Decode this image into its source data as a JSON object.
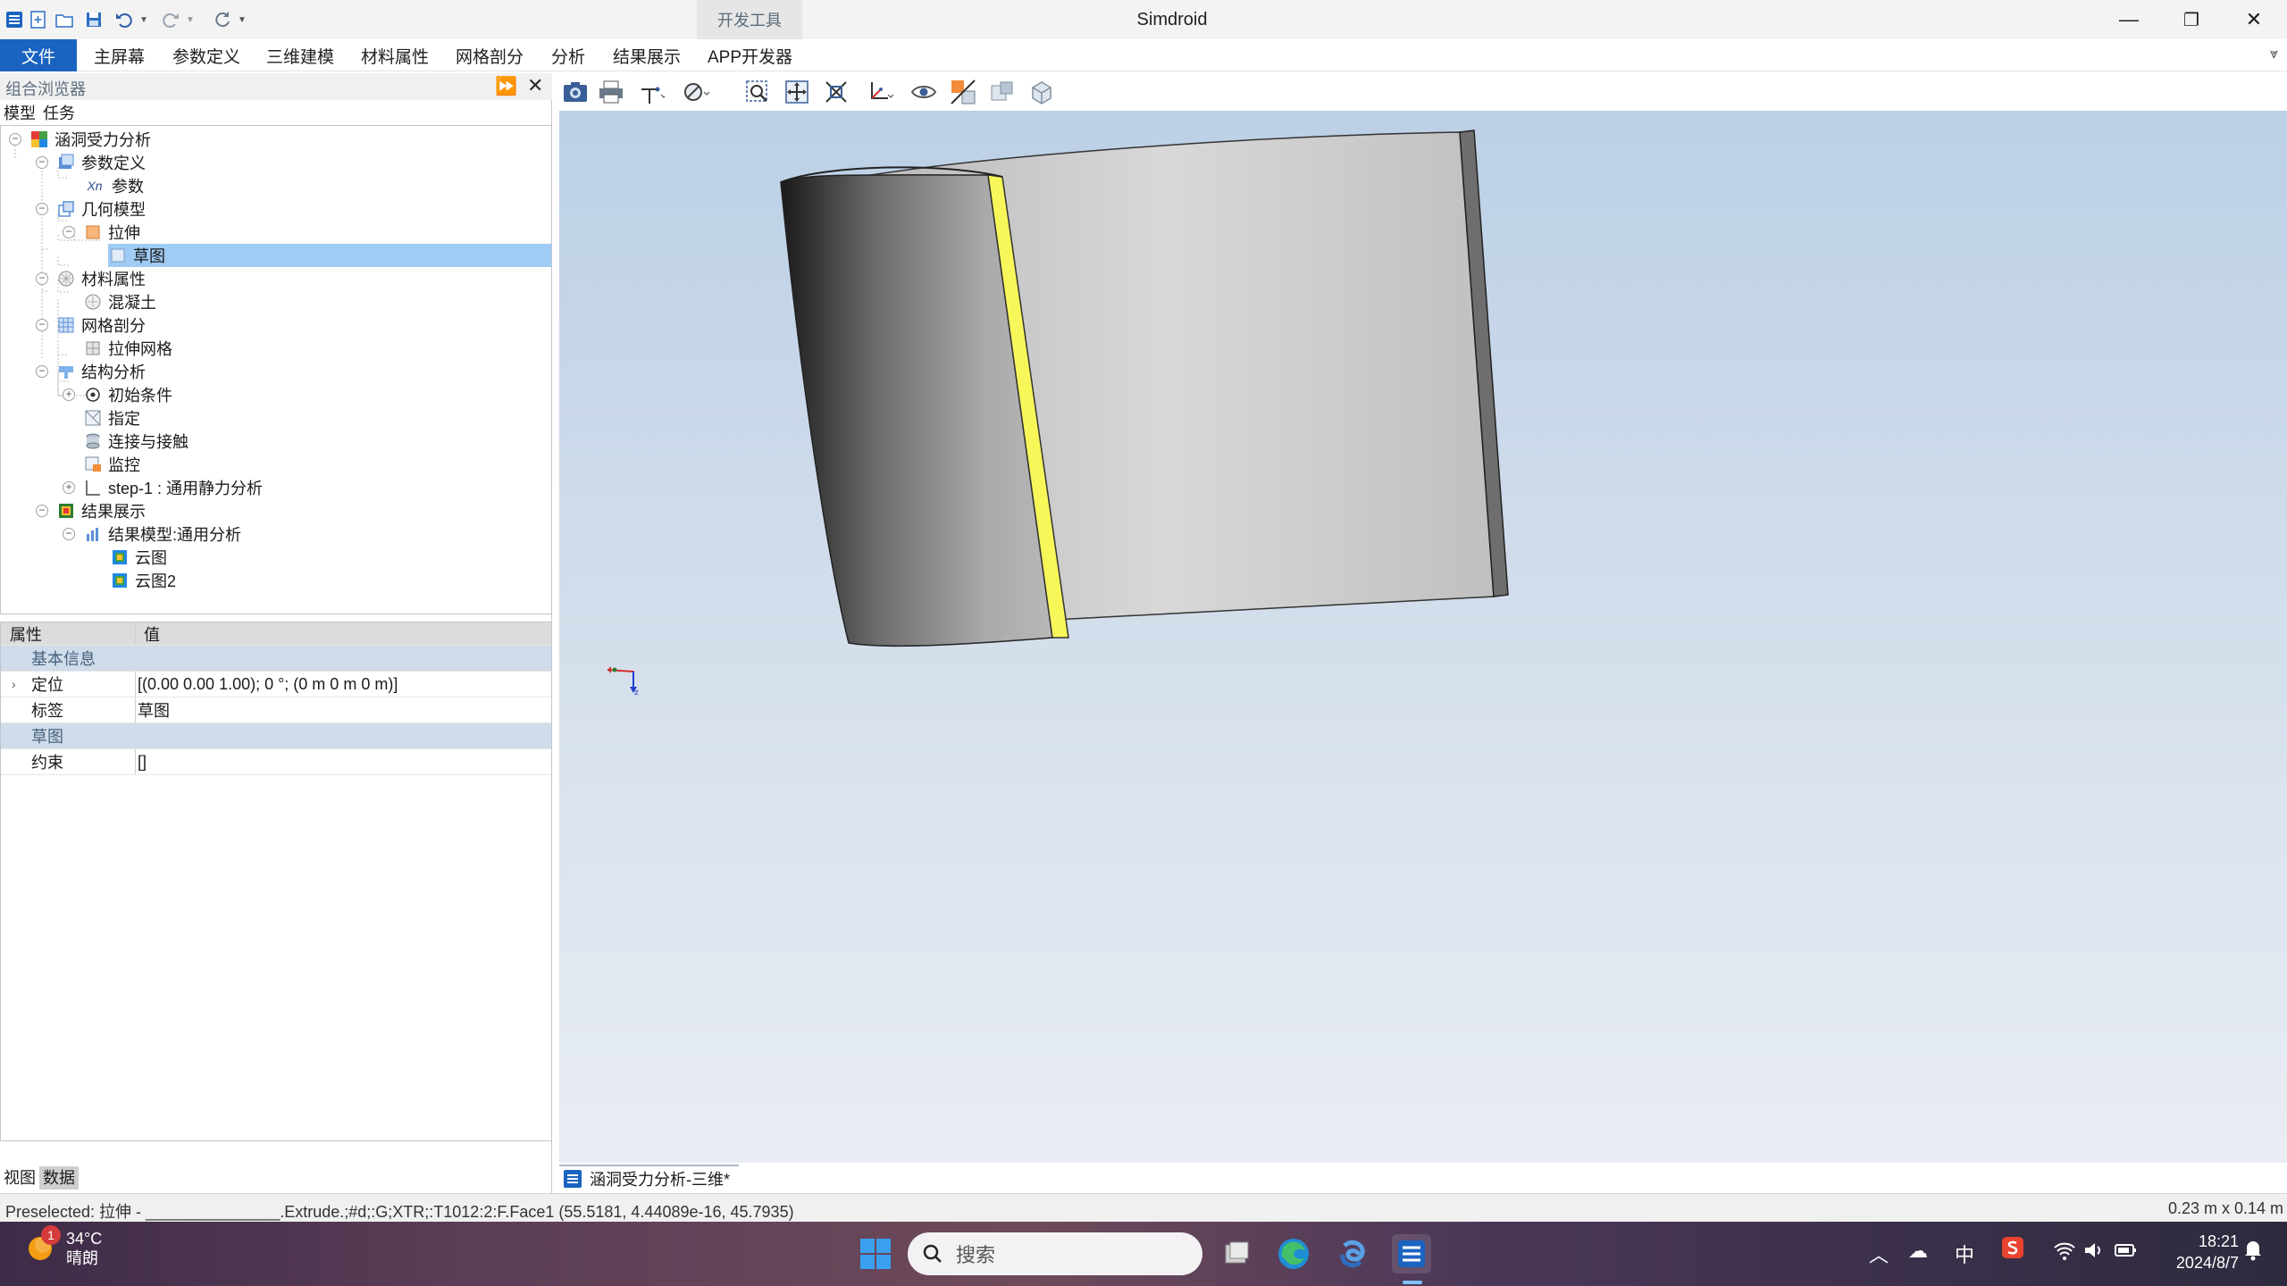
{
  "titlebar": {
    "app_title": "Simdroid",
    "context_tab": "开发工具",
    "minimize": "—",
    "restore": "❐",
    "close": "✕"
  },
  "menu": {
    "file": "文件",
    "items": [
      "主屏幕",
      "参数定义",
      "三维建模",
      "材料属性",
      "网格剖分",
      "分析",
      "结果展示",
      "APP开发器"
    ]
  },
  "left_panel": {
    "title": "组合浏览器",
    "tabs": [
      "模型",
      "任务"
    ],
    "bottom_tabs": [
      "视图",
      "数据"
    ]
  },
  "tree": {
    "root": "涵洞受力分析",
    "param_def": "参数定义",
    "params": "参数",
    "geom_model": "几何模型",
    "extrude": "拉伸",
    "sketch": "草图",
    "material": "材料属性",
    "concrete": "混凝土",
    "mesh": "网格剖分",
    "extrude_mesh": "拉伸网格",
    "struct": "结构分析",
    "init_cond": "初始条件",
    "assign": "指定",
    "contact": "连接与接触",
    "monitor": "监控",
    "step": "step-1 : 通用静力分析",
    "results": "结果展示",
    "result_model": "结果模型:通用分析",
    "contour1": "云图",
    "contour2": "云图2"
  },
  "props": {
    "col_prop": "属性",
    "col_value": "值",
    "group_basic": "基本信息",
    "placement_key": "定位",
    "placement_val": "[(0.00 0.00 1.00); 0 °; (0 m  0 m  0 m)]",
    "label_key": "标签",
    "label_val": "草图",
    "group_sketch": "草图",
    "constraint_key": "约束",
    "constraint_val": "[]"
  },
  "viewport": {
    "tab_label": "涵洞受力分析-三维*"
  },
  "status": {
    "text": "Preselected: 拉伸 - _______________.Extrude.;#d;:G;XTR;:T1012:2:F.Face1 (55.5181, 4.44089e-16, 45.7935)",
    "dimensions": "0.23 m x 0.14 m"
  },
  "taskbar": {
    "weather_temp": "34°C",
    "weather_desc": "晴朗",
    "badge": "1",
    "search_placeholder": "搜索",
    "ime": "中",
    "time": "18:21",
    "date": "2024/8/7"
  },
  "colors": {
    "accent": "#1a63c0",
    "selection": "#9fcbf5",
    "highlight_edge": "#f7f75a"
  }
}
